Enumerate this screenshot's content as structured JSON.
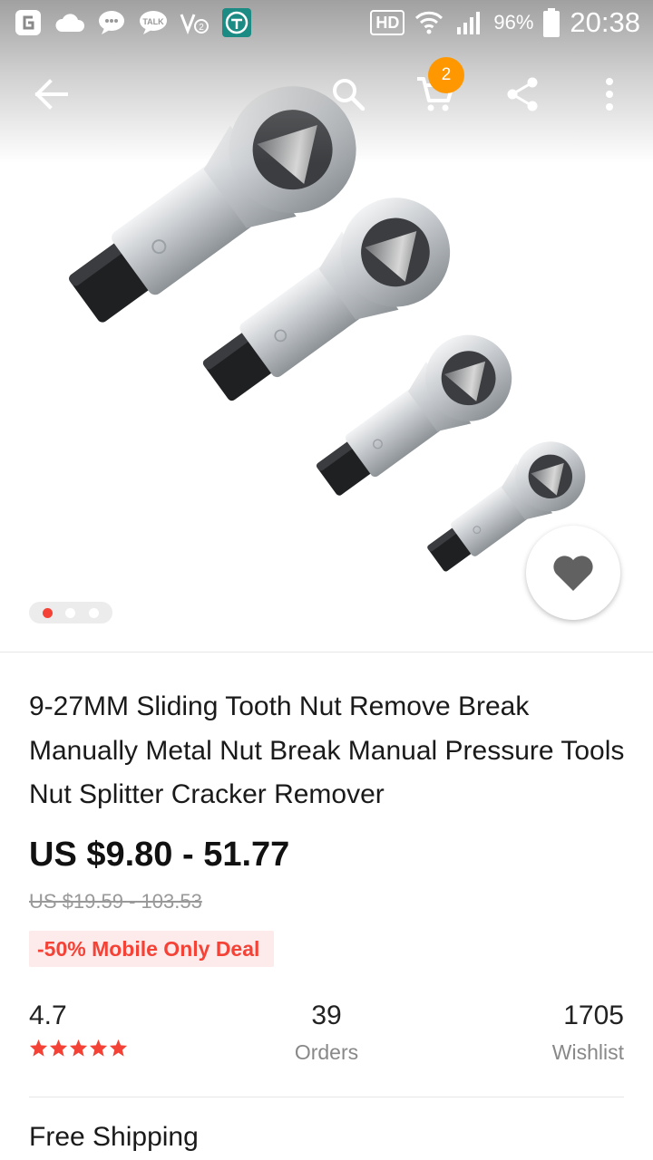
{
  "status_bar": {
    "left_icons": [
      "g-app-icon",
      "cloud-icon",
      "chat-icon",
      "talk-icon",
      "volte-icon",
      "app-icon"
    ],
    "hd_label": "HD",
    "battery": "96%",
    "time": "20:38"
  },
  "action_bar": {
    "cart_count": "2"
  },
  "carousel": {
    "total": 3,
    "active_index": 0
  },
  "product": {
    "title": "9-27MM Sliding Tooth Nut Remove Break Manually Metal Nut Break Manual Pressure Tools Nut Splitter Cracker Remover",
    "price": "US $9.80 - 51.77",
    "original_price": "US $19.59 - 103.53",
    "deal_label": "-50% Mobile Only Deal"
  },
  "stats": {
    "rating": "4.7",
    "stars": 5,
    "orders_count": "39",
    "orders_label": "Orders",
    "wishlist_count": "1705",
    "wishlist_label": "Wishlist"
  },
  "shipping": {
    "label": "Free Shipping"
  },
  "colors": {
    "accent_red": "#f44336",
    "badge_orange": "#ff9800"
  }
}
